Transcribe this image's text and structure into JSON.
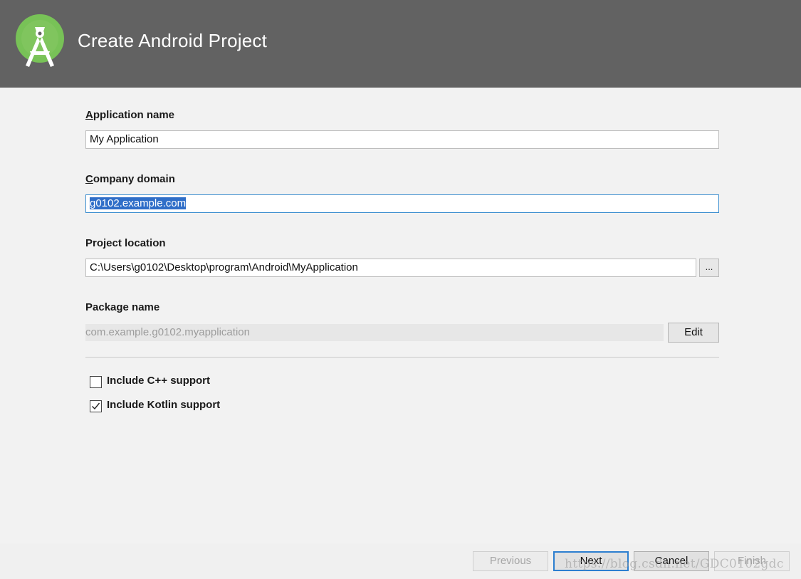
{
  "header": {
    "title": "Create Android Project",
    "logo_icon": "android-studio-logo-icon",
    "bg": "#626262"
  },
  "form": {
    "app_name": {
      "label_mnemonic": "A",
      "label_rest": "pplication name",
      "value": "My Application"
    },
    "company_domain": {
      "label_mnemonic": "C",
      "label_rest": "ompany domain",
      "value": "g0102.example.com"
    },
    "project_location": {
      "label": "Project location",
      "value": "C:\\Users\\g0102\\Desktop\\program\\Android\\MyApplication",
      "browse_label": "..."
    },
    "package_name": {
      "label": "Package name",
      "value": "com.example.g0102.myapplication",
      "edit_label": "Edit"
    },
    "options": [
      {
        "label": "Include C++ support",
        "checked": false
      },
      {
        "label": "Include Kotlin support",
        "checked": true
      }
    ]
  },
  "footer": {
    "previous": "Previous",
    "next": "Next",
    "cancel": "Cancel",
    "finish": "Finish"
  },
  "watermark": "https://blog.csdn.net/GDC0102gdc",
  "colors": {
    "accent": "#2c7fd0",
    "selection": "#2f6ec8"
  }
}
